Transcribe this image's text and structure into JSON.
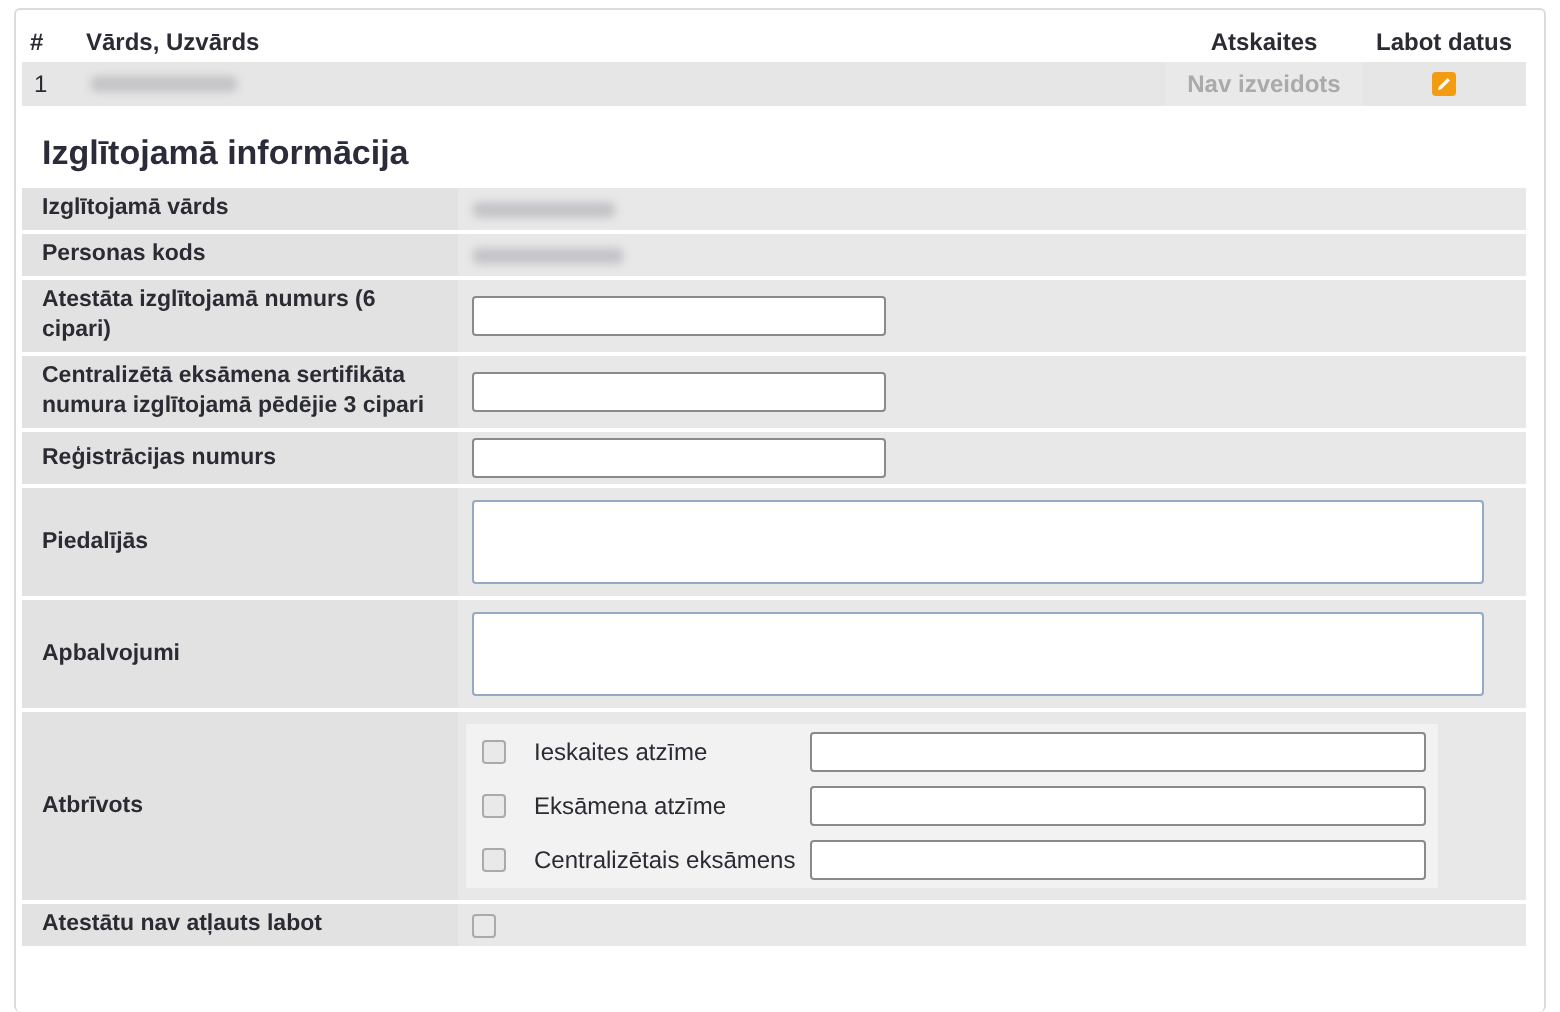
{
  "table": {
    "columns": [
      "#",
      "Vārds, Uzvārds",
      "Atskaites",
      "Labot datus"
    ],
    "rows": [
      {
        "number": "1",
        "reports": "Nav izveidots"
      }
    ]
  },
  "section_title": "Izglītojamā informācija",
  "fields": [
    {
      "label": "Izglītojamā vārds",
      "kind": "redacted"
    },
    {
      "label": "Personas kods",
      "kind": "redacted"
    },
    {
      "label": "Atestāta izglītojamā numurs (6 cipari)",
      "kind": "input"
    },
    {
      "label": "Centralizētā eksāmena sertifikāta numura izglītojamā pēdējie 3 cipari",
      "kind": "input"
    },
    {
      "label": "Reģistrācijas numurs",
      "kind": "input"
    },
    {
      "label": "Piedalījās",
      "kind": "textarea"
    },
    {
      "label": "Apbalvojumi",
      "kind": "textarea"
    },
    {
      "label": "Atbrīvots",
      "kind": "exemptions",
      "options": [
        {
          "label": "Ieskaites atzīme",
          "checked": false
        },
        {
          "label": "Eksāmena atzīme",
          "checked": false
        },
        {
          "label": "Centralizētais eksāmens",
          "checked": false
        }
      ]
    },
    {
      "label": "Atestātu nav atļauts labot",
      "kind": "checkbox",
      "checked": false
    }
  ]
}
